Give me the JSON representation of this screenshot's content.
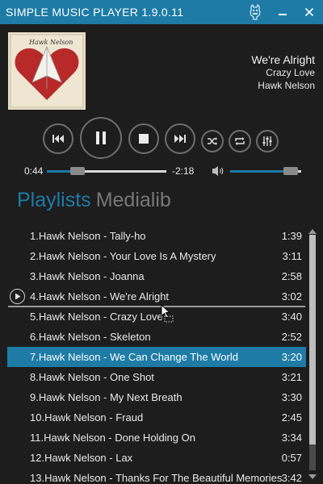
{
  "window": {
    "title": "SIMPLE MUSIC PLAYER 1.9.0.11",
    "icons": [
      "mascot-icon",
      "minimize-icon",
      "close-icon"
    ]
  },
  "now_playing": {
    "cover_text": "Hawk Nelson",
    "title": "We're Alright",
    "album": "Crazy Love",
    "artist": "Hawk Nelson"
  },
  "controls": [
    "previous-icon",
    "pause-icon",
    "stop-icon",
    "next-icon",
    "shuffle-icon",
    "repeat-icon",
    "equalizer-icon"
  ],
  "progress": {
    "elapsed": "0:44",
    "remaining": "-2:18",
    "fraction": 0.26
  },
  "volume": {
    "icon": "volume-icon",
    "level": 0.85
  },
  "tabs": {
    "active": "Playlists",
    "inactive": "Medialib"
  },
  "playlist": {
    "items": [
      {
        "num": "1.",
        "title": "Hawk Nelson - Tally-ho",
        "duration": "1:39"
      },
      {
        "num": "2.",
        "title": "Hawk Nelson - Your Love Is A Mystery",
        "duration": "3:11"
      },
      {
        "num": "3.",
        "title": "Hawk Nelson - Joanna",
        "duration": "2:58"
      },
      {
        "num": "4.",
        "title": "Hawk Nelson - We're Alright",
        "duration": "3:02"
      },
      {
        "num": "5.",
        "title": "Hawk Nelson - Crazy Love",
        "duration": "3:40"
      },
      {
        "num": "6.",
        "title": "Hawk Nelson - Skeleton",
        "duration": "2:52"
      },
      {
        "num": "7.",
        "title": "Hawk Nelson - We Can Change The World",
        "duration": "3:20"
      },
      {
        "num": "8.",
        "title": "Hawk Nelson - One Shot",
        "duration": "3:21"
      },
      {
        "num": "9.",
        "title": "Hawk Nelson - My Next Breath",
        "duration": "3:30"
      },
      {
        "num": "10.",
        "title": "Hawk Nelson - Fraud",
        "duration": "2:45"
      },
      {
        "num": "11.",
        "title": "Hawk Nelson - Done Holding On",
        "duration": "3:34"
      },
      {
        "num": "12.",
        "title": "Hawk Nelson - Lax",
        "duration": "0:57"
      },
      {
        "num": "13.",
        "title": "Hawk Nelson - Thanks For The Beautiful Memories",
        "duration": "3:42"
      }
    ]
  },
  "colors": {
    "accent": "#1d7ba6",
    "background": "#1d1d1d",
    "inactive_tab": "#777777",
    "control_border": "#6e6e6e"
  }
}
